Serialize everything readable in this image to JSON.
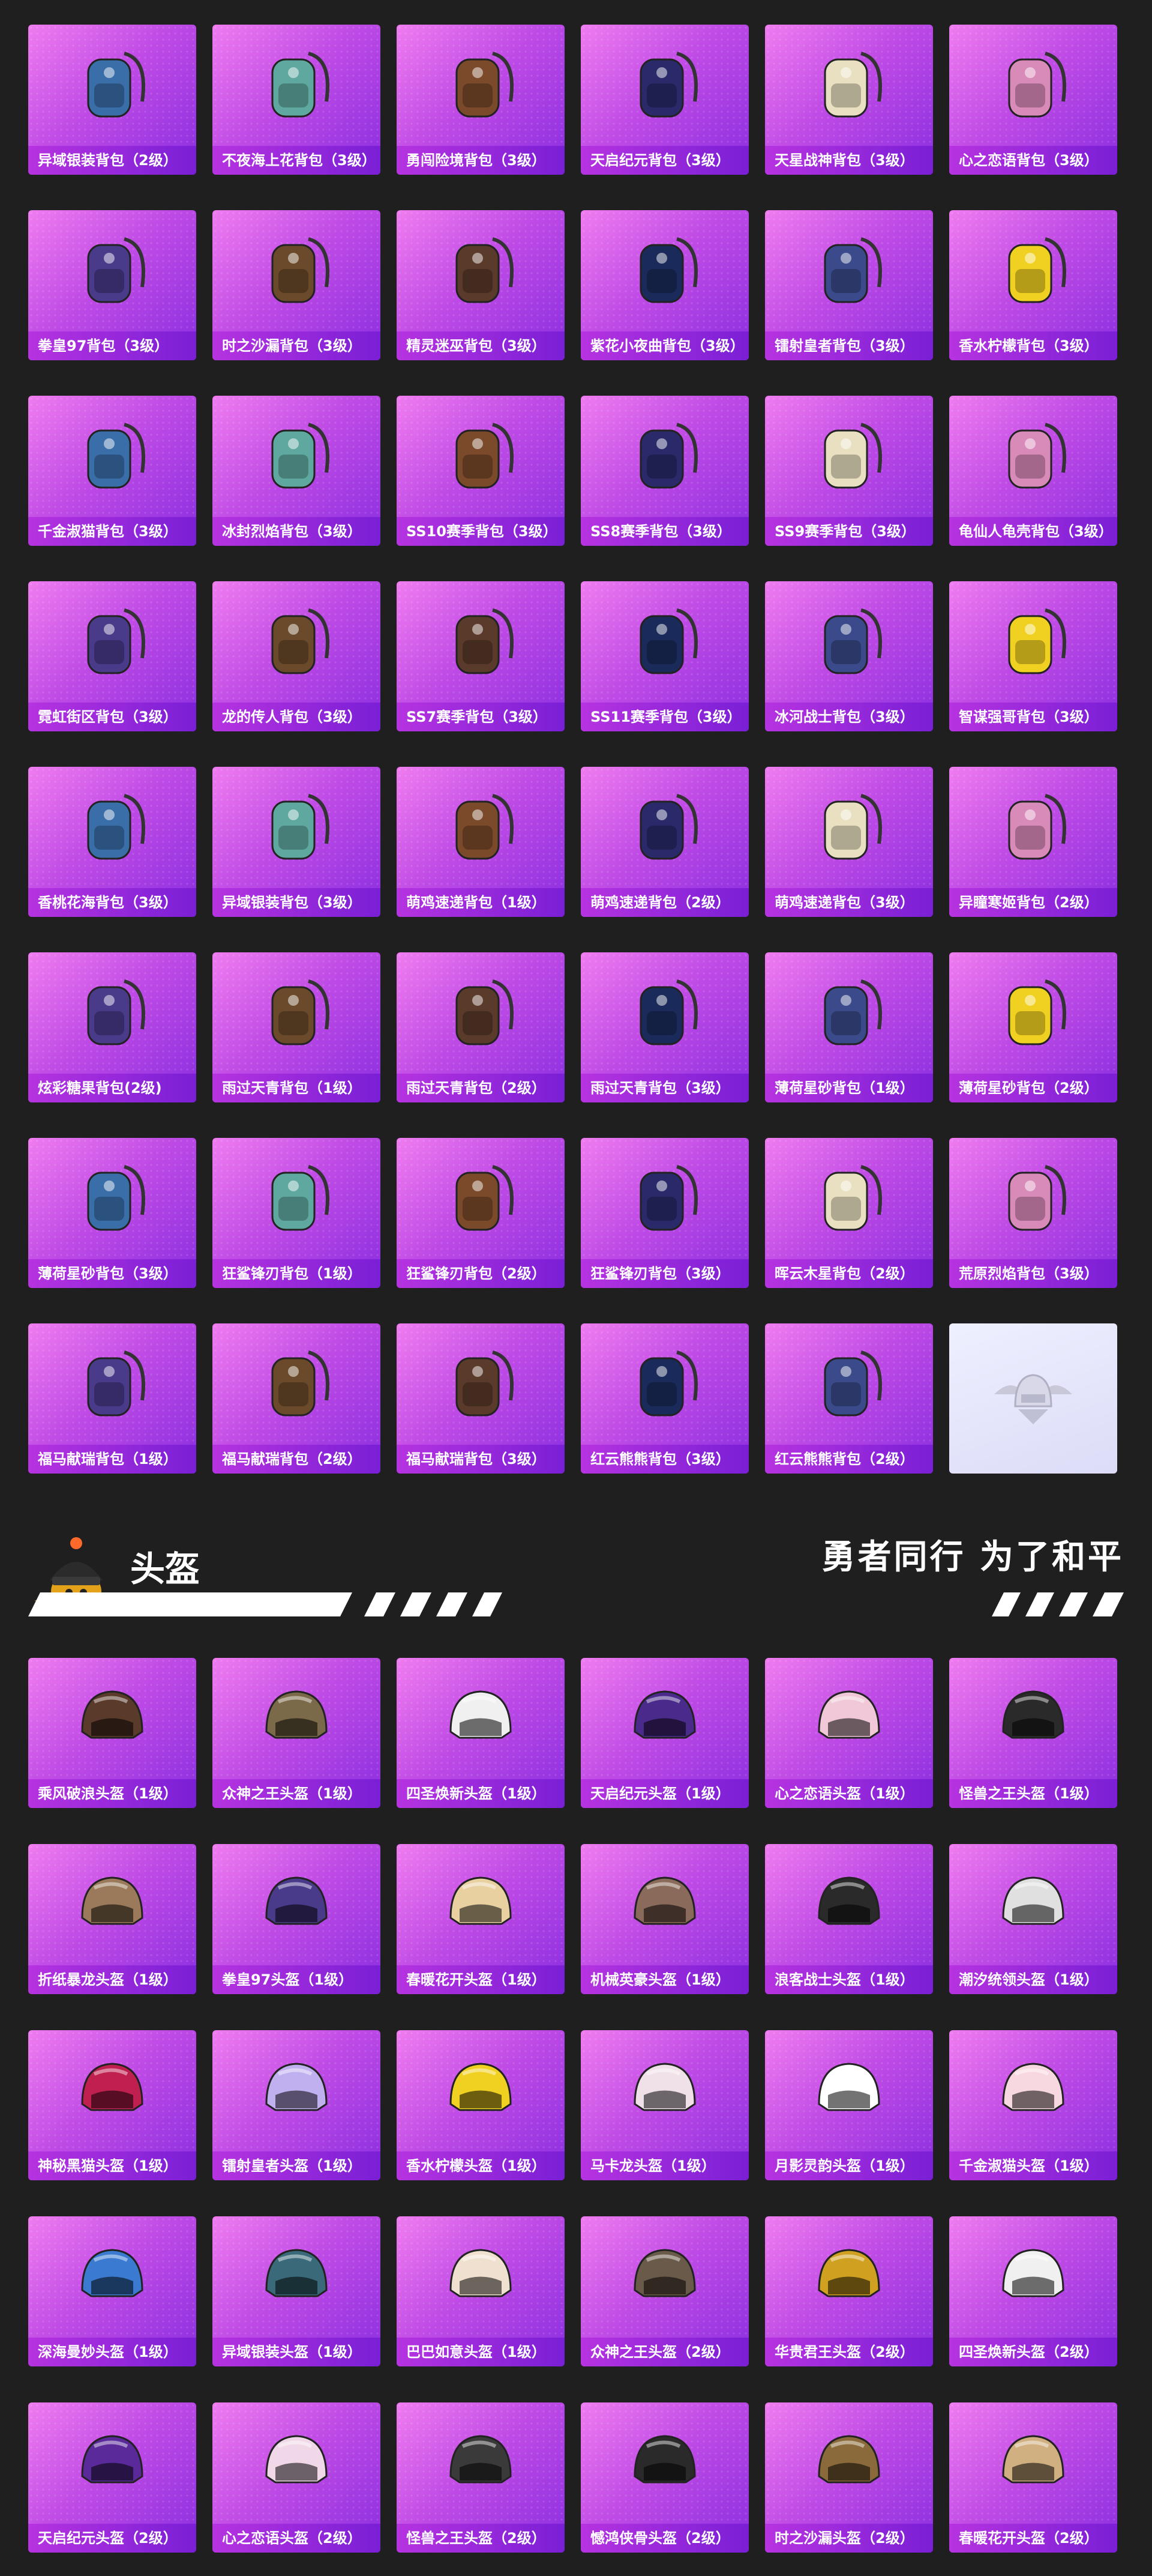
{
  "backpacks": {
    "items": [
      {
        "label": "异域银装背包（2级）",
        "icon": "backpack-icon"
      },
      {
        "label": "不夜海上花背包（3级）",
        "icon": "backpack-icon"
      },
      {
        "label": "勇闯险境背包（3级）",
        "icon": "backpack-icon"
      },
      {
        "label": "天启纪元背包（3级）",
        "icon": "backpack-icon"
      },
      {
        "label": "天星战神背包（3级）",
        "icon": "backpack-icon"
      },
      {
        "label": "心之恋语背包（3级）",
        "icon": "backpack-icon"
      },
      {
        "label": "拳皇97背包（3级）",
        "icon": "backpack-icon"
      },
      {
        "label": "时之沙漏背包（3级）",
        "icon": "backpack-icon"
      },
      {
        "label": "精灵迷巫背包（3级）",
        "icon": "backpack-icon"
      },
      {
        "label": "紫花小夜曲背包（3级）",
        "icon": "backpack-icon"
      },
      {
        "label": "镭射皇者背包（3级）",
        "icon": "backpack-icon"
      },
      {
        "label": "香水柠檬背包（3级）",
        "icon": "backpack-icon"
      },
      {
        "label": "千金淑猫背包（3级）",
        "icon": "backpack-icon"
      },
      {
        "label": "冰封烈焰背包（3级）",
        "icon": "backpack-icon"
      },
      {
        "label": "SS10赛季背包（3级）",
        "icon": "backpack-icon"
      },
      {
        "label": "SS8赛季背包（3级）",
        "icon": "backpack-icon"
      },
      {
        "label": "SS9赛季背包（3级）",
        "icon": "backpack-icon"
      },
      {
        "label": "龟仙人龟壳背包（3级）",
        "icon": "backpack-icon"
      },
      {
        "label": "霓虹街区背包（3级）",
        "icon": "backpack-icon"
      },
      {
        "label": "龙的传人背包（3级）",
        "icon": "backpack-icon"
      },
      {
        "label": "SS7赛季背包（3级）",
        "icon": "backpack-icon"
      },
      {
        "label": "SS11赛季背包（3级）",
        "icon": "backpack-icon"
      },
      {
        "label": "冰河战士背包（3级）",
        "icon": "backpack-icon"
      },
      {
        "label": "智谋强哥背包（3级）",
        "icon": "backpack-icon"
      },
      {
        "label": "香桃花海背包（3级）",
        "icon": "backpack-icon"
      },
      {
        "label": "异域银装背包（3级）",
        "icon": "backpack-icon"
      },
      {
        "label": "萌鸡速递背包（1级）",
        "icon": "backpack-icon"
      },
      {
        "label": "萌鸡速递背包（2级）",
        "icon": "backpack-icon"
      },
      {
        "label": "萌鸡速递背包（3级）",
        "icon": "backpack-icon"
      },
      {
        "label": "异瞳寒姬背包（2级）",
        "icon": "backpack-icon"
      },
      {
        "label": "炫彩糖果背包(2级)",
        "icon": "backpack-icon"
      },
      {
        "label": "雨过天青背包（1级）",
        "icon": "backpack-icon"
      },
      {
        "label": "雨过天青背包（2级）",
        "icon": "backpack-icon"
      },
      {
        "label": "雨过天青背包（3级）",
        "icon": "backpack-icon"
      },
      {
        "label": "薄荷星砂背包（1级）",
        "icon": "backpack-icon"
      },
      {
        "label": "薄荷星砂背包（2级）",
        "icon": "backpack-icon"
      },
      {
        "label": "薄荷星砂背包（3级）",
        "icon": "backpack-icon"
      },
      {
        "label": "狂鲨锋刃背包（1级）",
        "icon": "backpack-icon"
      },
      {
        "label": "狂鲨锋刃背包（2级）",
        "icon": "backpack-icon"
      },
      {
        "label": "狂鲨锋刃背包（3级）",
        "icon": "backpack-icon"
      },
      {
        "label": "晖云木星背包（2级）",
        "icon": "backpack-icon"
      },
      {
        "label": "荒原烈焰背包（3级）",
        "icon": "backpack-icon"
      },
      {
        "label": "福马献瑞背包（1级）",
        "icon": "backpack-icon"
      },
      {
        "label": "福马献瑞背包（2级）",
        "icon": "backpack-icon"
      },
      {
        "label": "福马献瑞背包（3级）",
        "icon": "backpack-icon"
      },
      {
        "label": "红云熊熊背包（3级）",
        "icon": "backpack-icon"
      },
      {
        "label": "红云熊熊背包（2级）",
        "icon": "backpack-icon"
      }
    ],
    "badge_icon": "winged-helmet-emblem-icon"
  },
  "helmet_section": {
    "title": "头盔",
    "slogan": "勇者同行 为了和平",
    "mascot_icon": "chick-helmet-mascot-icon"
  },
  "helmets": {
    "items": [
      {
        "label": "乘风破浪头盔（1级）",
        "icon": "helmet-icon"
      },
      {
        "label": "众神之王头盔（1级）",
        "icon": "helmet-icon"
      },
      {
        "label": "四圣焕新头盔（1级）",
        "icon": "helmet-icon"
      },
      {
        "label": "天启纪元头盔（1级）",
        "icon": "helmet-icon"
      },
      {
        "label": "心之恋语头盔（1级）",
        "icon": "helmet-icon"
      },
      {
        "label": "怪兽之王头盔（1级）",
        "icon": "helmet-icon"
      },
      {
        "label": "折纸暴龙头盔（1级）",
        "icon": "helmet-icon"
      },
      {
        "label": "拳皇97头盔（1级）",
        "icon": "helmet-icon"
      },
      {
        "label": "春暖花开头盔（1级）",
        "icon": "helmet-icon"
      },
      {
        "label": "机械英豪头盔（1级）",
        "icon": "helmet-icon"
      },
      {
        "label": "浪客战士头盔（1级）",
        "icon": "helmet-icon"
      },
      {
        "label": "潮汐统领头盔（1级）",
        "icon": "helmet-icon"
      },
      {
        "label": "神秘黑猫头盔（1级）",
        "icon": "helmet-icon"
      },
      {
        "label": "镭射皇者头盔（1级）",
        "icon": "helmet-icon"
      },
      {
        "label": "香水柠檬头盔（1级）",
        "icon": "helmet-icon"
      },
      {
        "label": "马卡龙头盔（1级）",
        "icon": "helmet-icon"
      },
      {
        "label": "月影灵韵头盔（1级）",
        "icon": "helmet-icon"
      },
      {
        "label": "千金淑猫头盔（1级）",
        "icon": "helmet-icon"
      },
      {
        "label": "深海曼妙头盔（1级）",
        "icon": "helmet-icon"
      },
      {
        "label": "异域银装头盔（1级）",
        "icon": "helmet-icon"
      },
      {
        "label": "巴巴如意头盔（1级）",
        "icon": "helmet-icon"
      },
      {
        "label": "众神之王头盔（2级）",
        "icon": "helmet-icon"
      },
      {
        "label": "华贵君王头盔（2级）",
        "icon": "helmet-icon"
      },
      {
        "label": "四圣焕新头盔（2级）",
        "icon": "helmet-icon"
      },
      {
        "label": "天启纪元头盔（2级）",
        "icon": "helmet-icon"
      },
      {
        "label": "心之恋语头盔（2级）",
        "icon": "helmet-icon"
      },
      {
        "label": "怪兽之王头盔（2级）",
        "icon": "helmet-icon"
      },
      {
        "label": "憾鸿侠骨头盔（2级）",
        "icon": "helmet-icon"
      },
      {
        "label": "时之沙漏头盔（2级）",
        "icon": "helmet-icon"
      },
      {
        "label": "春暖花开头盔（2级）",
        "icon": "helmet-icon"
      }
    ]
  },
  "colors": {
    "page_bg": "#1f1f1f",
    "card_gradient_start": "#f07cf0",
    "card_gradient_end": "#8a2ee0",
    "label_bar": "#7a1fd6"
  }
}
